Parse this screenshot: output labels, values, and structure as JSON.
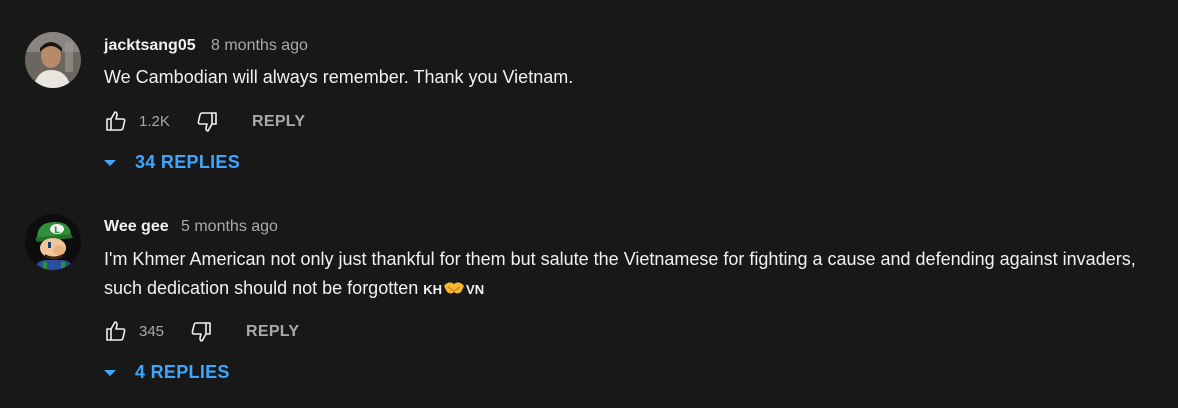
{
  "comments": [
    {
      "author": "jacktsang05",
      "time": "8 months ago",
      "text": "We Cambodian will always remember.  Thank you Vietnam.",
      "likes": "1.2K",
      "reply_label": "REPLY",
      "replies_label": "34 REPLIES"
    },
    {
      "author": "Wee gee",
      "time": "5 months ago",
      "text": "I'm Khmer American not only just thankful for them but salute the Vietnamese for fighting a cause and defending against invaders, such dedication should not be forgotten",
      "flag_left": "KH",
      "flag_right": "VN",
      "likes": "345",
      "reply_label": "REPLY",
      "replies_label": "4 REPLIES"
    }
  ],
  "colors": {
    "background": "#181818",
    "text": "#f1f1f1",
    "muted": "#aaaaaa",
    "link": "#3ea6ff"
  }
}
